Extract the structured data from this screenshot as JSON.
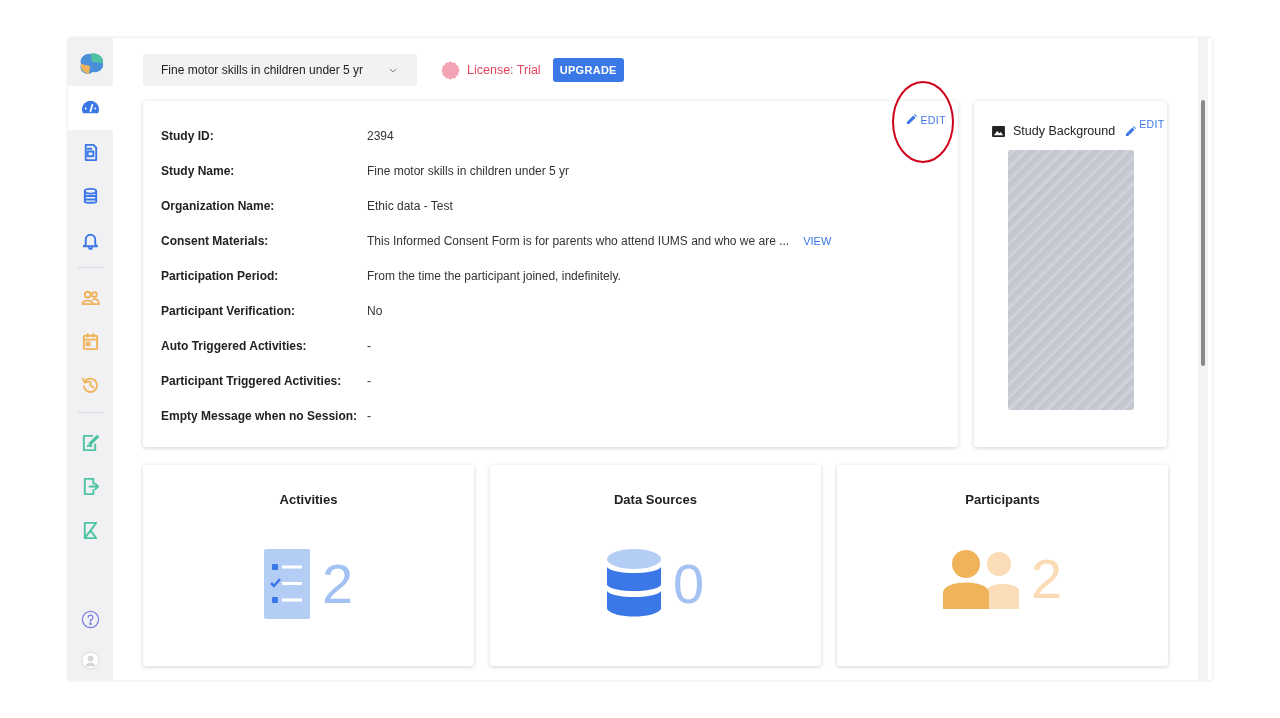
{
  "sidebar": {
    "groups": [
      {
        "items": [
          {
            "selected": true,
            "color": "#3b78e7"
          },
          {
            "selected": false,
            "color": "#3b78e7"
          },
          {
            "selected": false,
            "color": "#3b78e7"
          },
          {
            "selected": false,
            "color": "#3b78e7"
          }
        ]
      },
      {
        "items": [
          {
            "selected": false,
            "color": "#f0b35a"
          },
          {
            "selected": false,
            "color": "#f0b35a"
          },
          {
            "selected": false,
            "color": "#f0b35a"
          }
        ]
      },
      {
        "items": [
          {
            "selected": false,
            "color": "#4fc3a1"
          },
          {
            "selected": false,
            "color": "#4fc3a1"
          },
          {
            "selected": false,
            "color": "#4fc3a1"
          }
        ]
      }
    ]
  },
  "header": {
    "study_select": {
      "value": "Fine motor skills in children under 5 yr"
    },
    "license": "License: Trial",
    "upgrade_button": "UPGRADE"
  },
  "study_info": {
    "edit_button": "EDIT",
    "rows": [
      {
        "label": "Study ID:",
        "value": "2394"
      },
      {
        "label": "Study Name:",
        "value": "Fine motor skills in children under 5 yr"
      },
      {
        "label": "Organization Name:",
        "value": "Ethic data - Test"
      },
      {
        "label": "Consent Materials:",
        "value": "This Informed Consent Form is for parents who attend IUMS and who we are ...",
        "action": "VIEW"
      },
      {
        "label": "Participation Period:",
        "value": "From the time the participant joined, indefinitely."
      },
      {
        "label": "Participant Verification:",
        "value": "No"
      },
      {
        "label": "Auto Triggered Activities:",
        "value": "-"
      },
      {
        "label": "Participant Triggered Activities:",
        "value": "-"
      },
      {
        "label": "Empty Message when no Session:",
        "value": "-"
      }
    ]
  },
  "study_background": {
    "title": "Study Background",
    "edit_button": "EDIT"
  },
  "stat_cards": [
    {
      "kind": "activities",
      "title": "Activities",
      "value": "2"
    },
    {
      "kind": "data_sources",
      "title": "Data Sources",
      "value": "0"
    },
    {
      "kind": "participants",
      "title": "Participants",
      "value": "2"
    }
  ]
}
